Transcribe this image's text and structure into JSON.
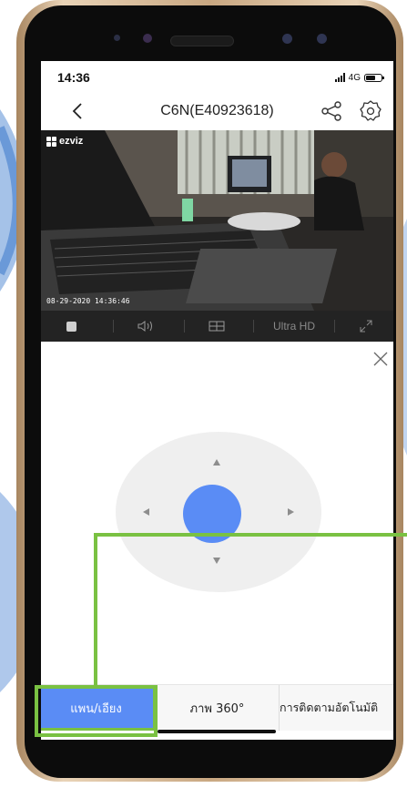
{
  "status_bar": {
    "time": "14:36",
    "network": "4G"
  },
  "nav": {
    "title": "C6N(E40923618)"
  },
  "video": {
    "brand": "ezviz",
    "timestamp": "08-29-2020 14:36:46"
  },
  "controls": {
    "quality_label": "Ultra HD"
  },
  "tabs": {
    "pan_tilt": "แพน/เอียง",
    "image_360": "ภาพ 360°",
    "auto_tracking": "การติดตามอัตโนมัติ"
  },
  "colors": {
    "accent_blue": "#5a8cf5",
    "highlight_green": "#7ac142"
  }
}
